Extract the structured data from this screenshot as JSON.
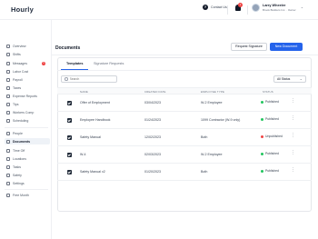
{
  "app": {
    "name": "Hourly"
  },
  "topbar": {
    "contact_label": "Contact Us",
    "notification_count": "1",
    "user": {
      "name": "Larry Wheeler",
      "role": "Brook Builders Inc. · Owner"
    }
  },
  "sidebar": {
    "items": [
      {
        "label": "Overview"
      },
      {
        "label": "Shifts"
      },
      {
        "label": "Messages",
        "badge": "1"
      },
      {
        "label": "Labor Cost"
      },
      {
        "label": "Payroll"
      },
      {
        "label": "Taxes"
      },
      {
        "label": "Expense Reports"
      },
      {
        "label": "Tips"
      },
      {
        "label": "Workers Comp"
      },
      {
        "label": "Scheduling"
      },
      {
        "label": "People"
      },
      {
        "label": "Documents"
      },
      {
        "label": "Time Off"
      },
      {
        "label": "Locations"
      },
      {
        "label": "Tasks"
      },
      {
        "label": "Safety"
      },
      {
        "label": "Settings"
      }
    ],
    "footer": {
      "label": "Free Month"
    }
  },
  "page": {
    "title": "Documents",
    "request_signature_label": "Request Signature",
    "new_document_label": "New Document"
  },
  "tabs": [
    {
      "label": "Templates"
    },
    {
      "label": "Signature Requests"
    }
  ],
  "search": {
    "placeholder": "Search"
  },
  "filter": {
    "value": "All Status"
  },
  "table": {
    "headers": [
      "NAME",
      "CREATED DATE",
      "EMPLOYEE TYPE",
      "STATUS"
    ],
    "rows": [
      {
        "name": "Offer of Employment",
        "created": "03/04/2023",
        "type": "W-2 Employee",
        "status": "Published"
      },
      {
        "name": "Employee Handbook",
        "created": "01/24/2023",
        "type": "1099 Contractor (W-9 only)",
        "status": "Published"
      },
      {
        "name": "Safety Manual",
        "created": "12/02/2023",
        "type": "Both",
        "status": "Unpublished"
      },
      {
        "name": "W-4",
        "created": "02/03/2023",
        "type": "W-2 Employee",
        "status": "Published"
      },
      {
        "name": "Safety Manual v2",
        "created": "01/20/2023",
        "type": "Both",
        "status": "Published"
      }
    ]
  },
  "colors": {
    "accent": "#2563eb",
    "published": "#22c55e",
    "unpublished": "#ef4444",
    "badge": "#ef4444"
  }
}
